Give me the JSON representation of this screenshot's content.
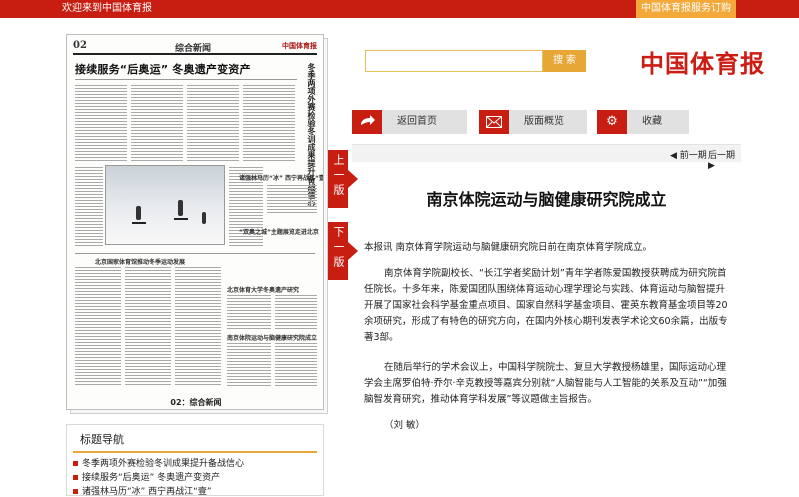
{
  "topbar": {
    "welcome": "欢迎来到中国体育报",
    "subscribe": "中国体育报服务订购"
  },
  "thumbnail": {
    "page_number": "02",
    "section": "综合新闻",
    "masthead": "中国体育报",
    "headline": "接续服务“后奥运” 冬奥遗产变资产",
    "vertical_headline": "冬季两项外赛检验冬训成果提升备战信心",
    "small_headlines": [
      "诸强林马历“冰” 西宁再战江“壹”",
      "“双奥之城”主题展览走进北京",
      "北京国家体育馆推动冬季运动发展",
      "北京体育大学冬奥遗产研究",
      "南京体院运动与脑健康研究院成立"
    ],
    "caption": "02：综合新闻"
  },
  "edition_tabs": {
    "previous": "上一版",
    "next": "下一版"
  },
  "search": {
    "placeholder": "",
    "button": "搜 索"
  },
  "brand": "中国体育报",
  "toolbar": {
    "home": "返回首页",
    "layout": "版面概览",
    "favorite": "收藏"
  },
  "pager": {
    "prev": "◀ 前一期",
    "next": "后一期 ▶"
  },
  "article": {
    "title": "南京体院运动与脑健康研究院成立",
    "paragraphs": [
      "本报讯  南京体育学院运动与脑健康研究院日前在南京体育学院成立。",
      "南京体育学院副校长、“长江学者奖励计划”青年学者陈爱国教授获聘成为研究院首任院长。十多年来，陈爱国团队围绕体育运动心理学理论与实践、体育运动与脑智提升开展了国家社会科学基金重点项目、国家自然科学基金项目、霍英东教育基金项目等20余项研究，形成了有特色的研究方向，在国内外核心期刊发表学术论文60余篇，出版专著3部。",
      "在随后举行的学术会议上，中国科学院院士、复旦大学教授杨雄里，国际运动心理学会主席罗伯特·乔尔·辛克教授等嘉宾分别就“人脑智能与人工智能的关系及互动”“加强脑智发育研究，推动体育学科发展”等议题做主旨报告。",
      "（刘  敏）"
    ]
  },
  "nav": {
    "title": "标题导航",
    "items": [
      "冬季两项外赛检验冬训成果提升备战信心",
      "接续服务“后奥运” 冬奥遗产变资产",
      "诸强林马历“冰” 西宁再战江“壹”"
    ]
  },
  "colors": {
    "brand_red": "#c81d11",
    "accent_orange": "#e7a737",
    "toolbar_gray": "#e1e1e1"
  }
}
